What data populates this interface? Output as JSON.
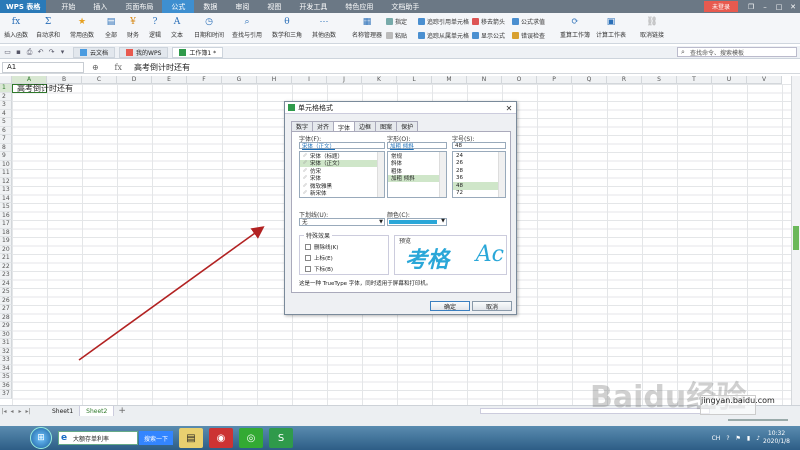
{
  "app": {
    "logo": "WPS 表格",
    "menu_tabs": [
      "开始",
      "插入",
      "页面布局",
      "公式",
      "数据",
      "审阅",
      "视图",
      "开发工具",
      "特色应用",
      "文档助手"
    ],
    "active_tab": "公式",
    "login": "未登录"
  },
  "ribbon": {
    "insert_function": "插入函数",
    "autosum": "自动求和",
    "common": "常用函数",
    "all": "全部",
    "finance": "财务",
    "logic": "逻辑",
    "text": "文本",
    "datetime": "日期和时间",
    "lookup": "查找与引用",
    "math": "数学和三角",
    "other": "其他函数",
    "name_manager": "名称管理器",
    "specify": "指定",
    "paste": "粘贴",
    "trace_prec": "追踪引用单元格",
    "trace_dep": "追踪从属单元格",
    "remove_arrows": "移去箭头",
    "show_formula": "显示公式",
    "formula_eval": "公式求值",
    "error_check": "错误检查",
    "recalc": "重算工作簿",
    "calc_sheet": "计算工作表",
    "cancel_link": "取消链接"
  },
  "doctabs": {
    "cloud": "云文档",
    "mywps": "我的WPS",
    "workbook": "工作簿1 *",
    "search": "查找命令、搜索模板"
  },
  "formula_bar": {
    "cell_ref": "A1",
    "fx": "fx",
    "content": "高考倒计时还有"
  },
  "sheet": {
    "columns": [
      "A",
      "B",
      "C",
      "D",
      "E",
      "F",
      "G",
      "H",
      "I",
      "J",
      "K",
      "L",
      "M",
      "N",
      "O",
      "P",
      "Q",
      "R",
      "S",
      "T",
      "U",
      "V"
    ],
    "rows": [
      "1",
      "2",
      "3",
      "4",
      "5",
      "6",
      "7",
      "8",
      "9",
      "10",
      "11",
      "12",
      "13",
      "14",
      "15",
      "16",
      "17",
      "18",
      "19",
      "20",
      "21",
      "22",
      "23",
      "24",
      "25",
      "26",
      "27",
      "28",
      "29",
      "30",
      "31",
      "32",
      "33",
      "34",
      "35",
      "36",
      "37"
    ],
    "a1_text": "高考倒计时还有"
  },
  "sheet_tabs": [
    "Sheet1",
    "Sheet2"
  ],
  "active_sheet": "Sheet2",
  "dialog": {
    "title": "单元格格式",
    "tabs": [
      "数字",
      "对齐",
      "字体",
      "边框",
      "图案",
      "保护"
    ],
    "active_tab": "字体",
    "font_label": "字体(F):",
    "font_value": "宋体（正文）",
    "style_label": "字形(O):",
    "style_value": "加粗 倾斜",
    "size_label": "字号(S):",
    "size_value": "48",
    "font_list": [
      "宋体（标题）",
      "宋体（正文）",
      "仿宋",
      "宋体",
      "微软雅黑",
      "新宋体"
    ],
    "font_selected": "宋体（正文）",
    "style_list": [
      "常规",
      "斜体",
      "粗体",
      "加粗 倾斜"
    ],
    "style_selected": "加粗 倾斜",
    "size_list": [
      "24",
      "26",
      "28",
      "36",
      "48",
      "72"
    ],
    "size_selected": "48",
    "underline_label": "下划线(U):",
    "underline_value": "无",
    "color_label": "颜色(C):",
    "color_value": "#2aa7d8",
    "effects_label": "特殊效果",
    "strike": "删除线(K)",
    "superscript": "上标(E)",
    "subscript": "下标(B)",
    "preview_label": "预览",
    "preview_text": "考格",
    "preview_text2": "Ac",
    "info": "这是一种 TrueType 字体，同时适用于屏幕和打印机。",
    "ok": "确定",
    "cancel": "取消"
  },
  "taskbar": {
    "ie_text": "大额存单利率",
    "baidu": "搜索一下",
    "lang": "CH",
    "time": "10:32",
    "date": "2020/1/8"
  },
  "watermark": "Baidu经验",
  "watermark_sub": "jingyan.baidu.com",
  "colors": {
    "accent": "#2f7a2b",
    "arrow": "#b22222",
    "preview": "#2aa7d8"
  }
}
